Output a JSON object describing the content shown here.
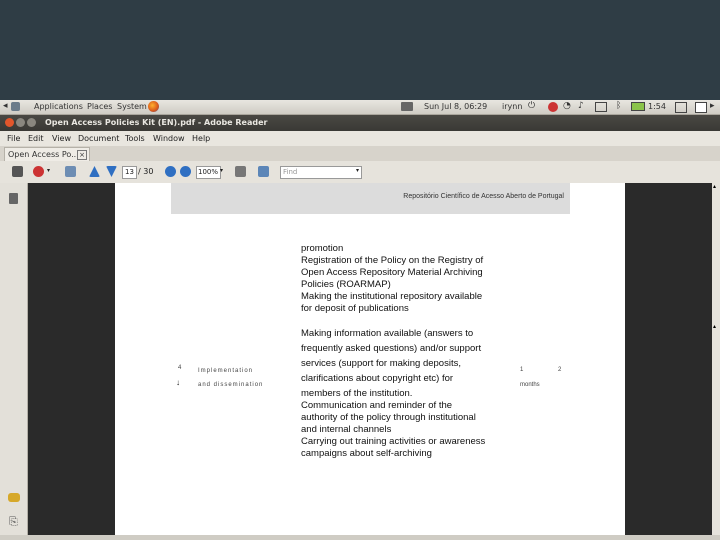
{
  "panel": {
    "applications": "Applications",
    "places": "Places",
    "system": "System",
    "datetime": "Sun Jul 8, 06:29",
    "user": "irynn",
    "battery": "1:54"
  },
  "window": {
    "title": "Open Access Policies Kit (EN).pdf - Adobe Reader"
  },
  "menu": {
    "items": [
      "File",
      "Edit",
      "View",
      "Document",
      "Tools",
      "Window",
      "Help"
    ]
  },
  "tab": {
    "label": "Open Access Po..."
  },
  "toolbar": {
    "page_current": "13",
    "page_total": "/ 30",
    "zoom": "100%",
    "find_placeholder": "Find"
  },
  "document": {
    "header_text": "Repositório Científico de Acesso Aberto de Portugal",
    "lines": [
      "promotion",
      "Registration of the Policy on the Registry of",
      "Open Access Repository Material Archiving",
      "Policies (ROARMAP)",
      "Making the institutional repository available",
      "for deposit of publications",
      "Making information available (answers to",
      "frequently asked questions) and/or support",
      "services (support for making deposits,",
      "clarifications about copyright etc) for",
      "members of the institution.",
      "Communication and reminder of the",
      "authority of the policy through institutional",
      "and internal channels",
      "Carrying out training activities or awareness",
      "campaigns about self-archiving"
    ],
    "left_label_1": "Implementation",
    "left_label_2": "and dissemination",
    "number_marker": "4",
    "right_col_1": "1",
    "right_col_2": "2",
    "right_col_3": "months"
  },
  "colors": {
    "background": "#2f3d45",
    "titlebar": "#3a3935",
    "viewer": "#2a2a2a"
  }
}
